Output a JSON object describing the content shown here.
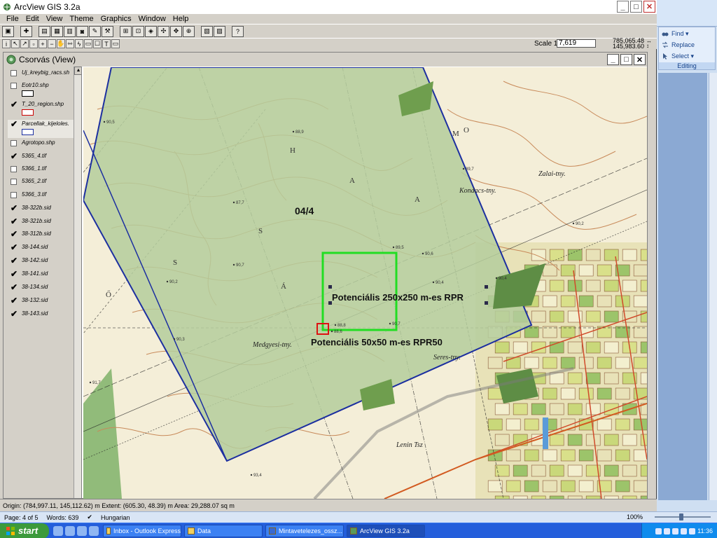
{
  "app": {
    "title": "ArcView GIS 3.2a",
    "menus": [
      "File",
      "Edit",
      "View",
      "Theme",
      "Graphics",
      "Window",
      "Help"
    ]
  },
  "toolbar2": {
    "scale_label": "Scale 1:",
    "scale_value": "7,619",
    "coord_x": "785,065.48",
    "coord_y": "145,983.60"
  },
  "view": {
    "title": "Csorvás (View)",
    "themes": [
      {
        "name": "Uj_kreybig_racs.sh",
        "checked": false,
        "symbol": null
      },
      {
        "name": "Eotr10.shp",
        "checked": false,
        "symbol": "#000000"
      },
      {
        "name": "T_20_region.shp",
        "checked": true,
        "symbol": "#cc0000"
      },
      {
        "name": "Parcellak_kijeloles.",
        "checked": true,
        "symbol": "#1c2fa0"
      },
      {
        "name": "Agrotopo.shp",
        "checked": false,
        "symbol": null
      },
      {
        "name": "5365_4.tif",
        "checked": true,
        "symbol": null
      },
      {
        "name": "5366_1.tif",
        "checked": false,
        "symbol": null
      },
      {
        "name": "5365_2.tif",
        "checked": false,
        "symbol": null
      },
      {
        "name": "5366_3.tif",
        "checked": false,
        "symbol": null
      },
      {
        "name": "38-322b.sid",
        "checked": true,
        "symbol": null
      },
      {
        "name": "38-321b.sid",
        "checked": true,
        "symbol": null
      },
      {
        "name": "38-312b.sid",
        "checked": true,
        "symbol": null
      },
      {
        "name": "38-144.sid",
        "checked": true,
        "symbol": null
      },
      {
        "name": "38-142.sid",
        "checked": true,
        "symbol": null
      },
      {
        "name": "38-141.sid",
        "checked": true,
        "symbol": null
      },
      {
        "name": "38-134.sid",
        "checked": true,
        "symbol": null
      },
      {
        "name": "38-132.sid",
        "checked": true,
        "symbol": null
      },
      {
        "name": "38-143.sid",
        "checked": true,
        "symbol": null
      }
    ]
  },
  "map": {
    "parcel_label": "04/4",
    "label_250": "Potenciális 250x250 m-es RPR",
    "label_50": "Potenciális 50x50 m-es RPR50",
    "place_names": [
      "Medgyesi-tny.",
      "Seres-tny.",
      "Kondacs-tny.",
      "Zalai-tny.",
      "Lenin Tsz"
    ],
    "area_letters": [
      "H",
      "A",
      "S",
      "Á",
      "S",
      "A",
      "O",
      "M",
      "Ő"
    ],
    "spot_heights": [
      "90,5",
      "88,9",
      "87,7",
      "90,7",
      "90,2",
      "88,8",
      "90,6",
      "90,4",
      "89,5",
      "90,7",
      "90,4",
      "89,7",
      "88,6",
      "90,2",
      "90,3",
      "91,7",
      "93,4"
    ],
    "colors": {
      "parcel_fill": "#b4cc9c",
      "parcel_border": "#1c2fa0",
      "rpr250": "#22dd22",
      "rpr50": "#dd1111"
    }
  },
  "status": {
    "text": "Origin: (784,997.11, 145,112.62) m  Extent: (605.30, 48.39) m  Area: 29,288.07 sq m"
  },
  "word": {
    "editing": {
      "find": "Find",
      "replace": "Replace",
      "select": "Select",
      "group_label": "Editing"
    },
    "status": {
      "page": "Page: 4 of 5",
      "words": "Words: 639",
      "language": "Hungarian",
      "zoom": "100%"
    }
  },
  "taskbar": {
    "start": "start",
    "tasks": [
      "Inbox - Outlook Express",
      "Data",
      "Mintavetelezes_ossz...",
      "ArcView GIS 3.2a"
    ],
    "clock": "11:36"
  }
}
